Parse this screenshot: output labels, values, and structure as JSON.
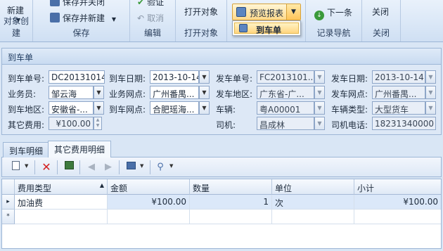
{
  "ribbon": {
    "new_label": "新建",
    "save_close_label": "保存并关闭",
    "save_new_label": "保存并新建",
    "audit_label": "验证",
    "cancel_label": "取消",
    "open_object_label": "打开对象",
    "preview_report_label": "预览报表",
    "preview_menu_item": "到车单",
    "next_label": "下一条",
    "close_label": "关闭",
    "groups": {
      "object_create": "对象创建",
      "save": "保存",
      "edit": "编辑",
      "open_object": "打开对象",
      "record_nav": "记录导航",
      "close": "关闭"
    }
  },
  "form": {
    "title": "到车单",
    "fields": {
      "arrival_no_label": "到车单号:",
      "arrival_no": "DC20131014",
      "arrival_date_label": "到车日期:",
      "arrival_date": "2013-10-14",
      "dispatch_no_label": "发车单号:",
      "dispatch_no": "FC2013101...",
      "dispatch_date_label": "发车日期:",
      "dispatch_date": "2013-10-14",
      "salesman_label": "业务员:",
      "salesman": "邹云海",
      "biz_outlet_label": "业务网点:",
      "biz_outlet": "广州番禺...",
      "dispatch_area_label": "发车地区:",
      "dispatch_area": "广东省-广...",
      "dispatch_outlet_label": "发车网点:",
      "dispatch_outlet": "广州番禺...",
      "arrival_area_label": "到车地区:",
      "arrival_area": "安徽省-...",
      "arrival_outlet_label": "到车网点:",
      "arrival_outlet": "合肥瑶海...",
      "vehicle_label": "车辆:",
      "vehicle": "粤A00001",
      "vehicle_type_label": "车辆类型:",
      "vehicle_type": "大型货车",
      "other_cost_label": "其它费用:",
      "other_cost": "¥100.00",
      "driver_label": "司机:",
      "driver": "昌成林",
      "driver_phone_label": "司机电话:",
      "driver_phone": "18231340000"
    }
  },
  "tabs": [
    {
      "label": "到车明细"
    },
    {
      "label": "其它费用明细"
    }
  ],
  "grid": {
    "columns": [
      "费用类型",
      "金额",
      "数量",
      "单位",
      "小计"
    ],
    "rows": [
      {
        "type": "加油费",
        "amount": "¥100.00",
        "qty": "1",
        "unit": "次",
        "subtotal": "¥100.00"
      }
    ],
    "new_row_marker": "*",
    "current_row_marker": "▸"
  },
  "colors": {
    "accent": "#d6a13a",
    "ribbon_bg": "#dbe8f7",
    "selected_row": "#dbe8f9"
  }
}
